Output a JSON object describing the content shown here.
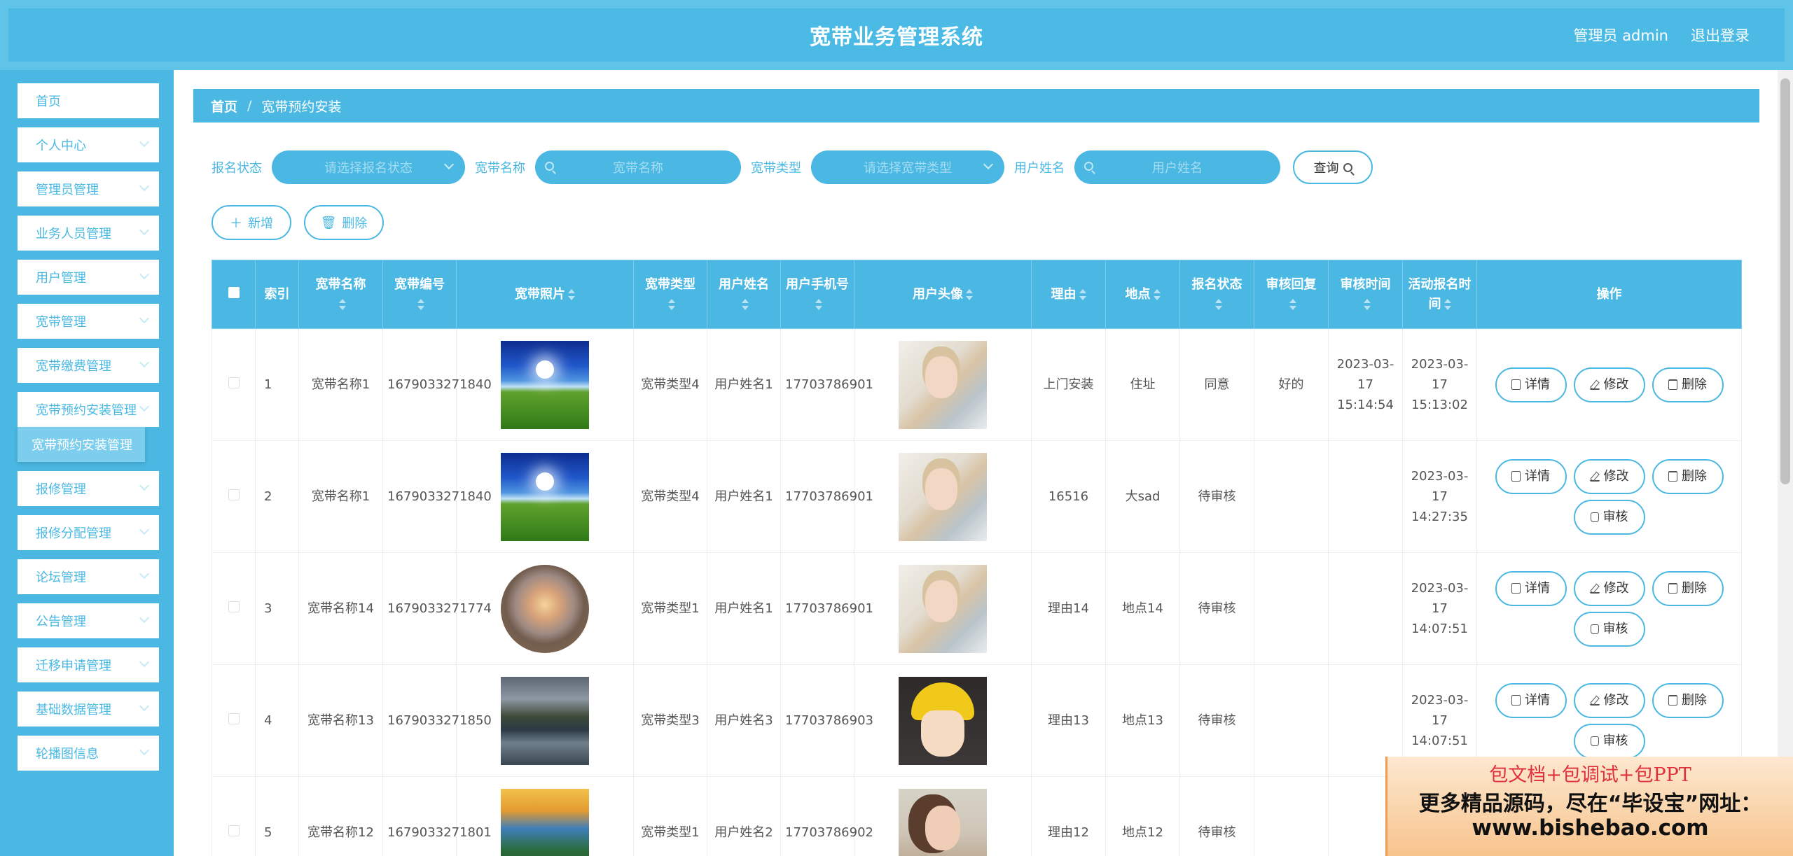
{
  "header": {
    "title": "宽带业务管理系统",
    "user": "管理员 admin",
    "logout": "退出登录"
  },
  "sidebar": {
    "items": [
      {
        "label": "首页"
      },
      {
        "label": "个人中心"
      },
      {
        "label": "管理员管理"
      },
      {
        "label": "业务人员管理"
      },
      {
        "label": "用户管理"
      },
      {
        "label": "宽带管理"
      },
      {
        "label": "宽带缴费管理"
      },
      {
        "label": "宽带预约安装管理"
      },
      {
        "label": "报修管理"
      },
      {
        "label": "报修分配管理"
      },
      {
        "label": "论坛管理"
      },
      {
        "label": "公告管理"
      },
      {
        "label": "迁移申请管理"
      },
      {
        "label": "基础数据管理"
      },
      {
        "label": "轮播图信息"
      }
    ],
    "active_sub": "宽带预约安装管理"
  },
  "breadcrumb": {
    "home": "首页",
    "separator": "/",
    "current": "宽带预约安装"
  },
  "filters": {
    "status_label": "报名状态",
    "status_placeholder": "请选择报名状态",
    "name_label": "宽带名称",
    "name_placeholder": "宽带名称",
    "type_label": "宽带类型",
    "type_placeholder": "请选择宽带类型",
    "user_label": "用户姓名",
    "user_placeholder": "用户姓名",
    "query": "查询"
  },
  "actions": {
    "add": "新增",
    "delete": "删除"
  },
  "table": {
    "headers": [
      "索引",
      "宽带名称",
      "宽带编号",
      "宽带照片",
      "宽带类型",
      "用户姓名",
      "用户手机号",
      "用户头像",
      "理由",
      "地点",
      "报名状态",
      "审核回复",
      "审核时间",
      "活动报名时间",
      "操作"
    ],
    "ops": {
      "detail": "详情",
      "edit": "修改",
      "delete": "删除",
      "review": "审核"
    },
    "rows": [
      {
        "index": "1",
        "name": "宽带名称1",
        "code": "1679033271840",
        "photo": "sky",
        "type": "宽带类型4",
        "user": "用户姓名1",
        "phone": "17703786901",
        "avatar": "boy",
        "reason": "上门安装",
        "place": "住址",
        "status": "同意",
        "reply": "好的",
        "review_time": "2023-03-17 15:14:54",
        "signup_time": "2023-03-17 15:13:02",
        "can_review": false
      },
      {
        "index": "2",
        "name": "宽带名称1",
        "code": "1679033271840",
        "photo": "sky",
        "type": "宽带类型4",
        "user": "用户姓名1",
        "phone": "17703786901",
        "avatar": "boy",
        "reason": "16516",
        "place": "大sad",
        "status": "待审核",
        "reply": "",
        "review_time": "",
        "signup_time": "2023-03-17 14:27:35",
        "can_review": true
      },
      {
        "index": "3",
        "name": "宽带名称14",
        "code": "1679033271774",
        "photo": "sunset",
        "type": "宽带类型1",
        "user": "用户姓名1",
        "phone": "17703786901",
        "avatar": "boy",
        "reason": "理由14",
        "place": "地点14",
        "status": "待审核",
        "reply": "",
        "review_time": "",
        "signup_time": "2023-03-17 14:07:51",
        "can_review": true
      },
      {
        "index": "4",
        "name": "宽带名称13",
        "code": "1679033271850",
        "photo": "lake",
        "type": "宽带类型3",
        "user": "用户姓名3",
        "phone": "17703786903",
        "avatar": "anime",
        "reason": "理由13",
        "place": "地点13",
        "status": "待审核",
        "reply": "",
        "review_time": "",
        "signup_time": "2023-03-17 14:07:51",
        "can_review": true
      },
      {
        "index": "5",
        "name": "宽带名称12",
        "code": "1679033271801",
        "photo": "meadow",
        "type": "宽带类型1",
        "user": "用户姓名2",
        "phone": "17703786902",
        "avatar": "girl",
        "reason": "理由12",
        "place": "地点12",
        "status": "待审核",
        "reply": "",
        "review_time": "",
        "signup_time": "",
        "can_review": true
      }
    ]
  },
  "promo": {
    "line1": "包文档+包调试+包PPT",
    "line2": "更多精品源码，尽在“毕设宝”网址：",
    "line3": "www.bishebao.com"
  }
}
